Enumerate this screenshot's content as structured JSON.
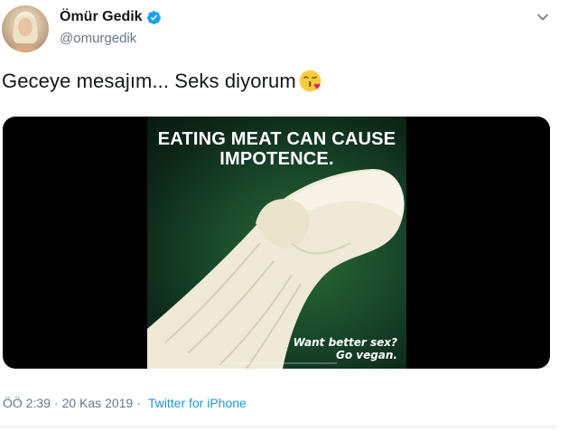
{
  "user": {
    "display_name": "Ömür Gedik",
    "handle": "@omurgedik"
  },
  "tweet": {
    "text": "Geceye mesajım... Seks diyorum",
    "emoji": "face-blowing-a-kiss"
  },
  "media": {
    "headline_line1": "EATING MEAT CAN CAUSE",
    "headline_line2": "IMPOTENCE.",
    "tagline_line1": "Want better sex?",
    "tagline_line2": "Go vegan."
  },
  "meta": {
    "time": "ÖÖ 2:39",
    "separator": "·",
    "date": "20 Kas 2019",
    "separator2": "·",
    "source": "Twitter for iPhone"
  },
  "colors": {
    "link": "#1b95e0",
    "verified": "#1da1f2",
    "secondary_text": "#657786",
    "divider": "#e6ecf0"
  }
}
